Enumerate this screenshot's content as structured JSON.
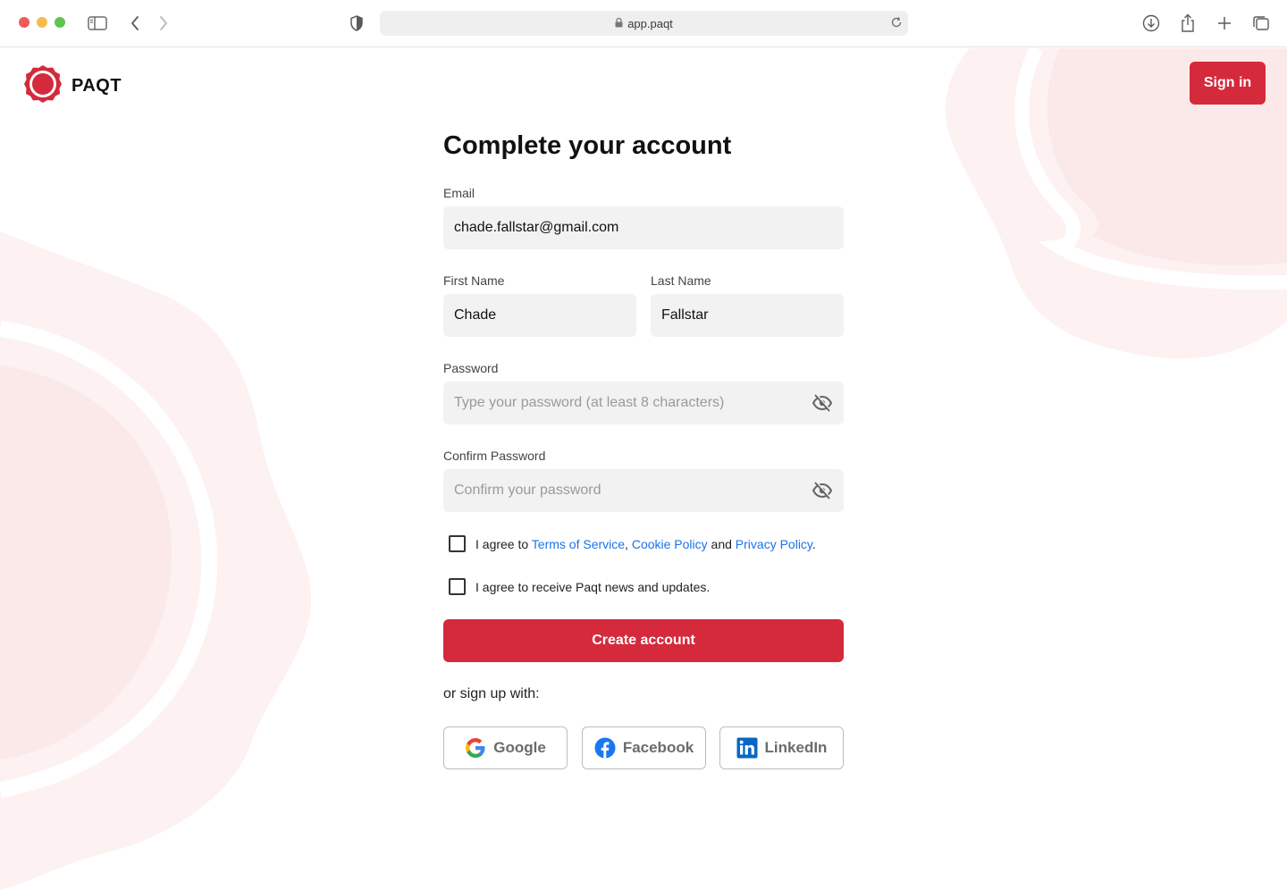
{
  "browser": {
    "url": "app.paqt"
  },
  "header": {
    "brand": "PAQT",
    "signin_label": "Sign in"
  },
  "form": {
    "title": "Complete your account",
    "email": {
      "label": "Email",
      "value": "chade.fallstar@gmail.com"
    },
    "first_name": {
      "label": "First Name",
      "value": "Chade"
    },
    "last_name": {
      "label": "Last Name",
      "value": "Fallstar"
    },
    "password": {
      "label": "Password",
      "placeholder": "Type your password (at least 8 characters)"
    },
    "confirm_password": {
      "label": "Confirm Password",
      "placeholder": "Confirm your password"
    },
    "terms": {
      "prefix": "I agree to ",
      "tos": "Terms of Service",
      "comma": ",",
      "cookie": "Cookie Policy",
      "and": " and ",
      "privacy": "Privacy Policy",
      "period": "."
    },
    "news": "I agree to receive Paqt news and updates.",
    "create_label": "Create account",
    "or_text": "or sign up with:",
    "social": {
      "google": "Google",
      "facebook": "Facebook",
      "linkedin": "LinkedIn"
    }
  },
  "colors": {
    "brand": "#d42a3c",
    "link": "#1a73e8",
    "field_bg": "#f2f2f2",
    "bg_shape": "#fdf1f1"
  },
  "icons": [
    "sidebar-icon",
    "back-icon",
    "forward-icon",
    "shield-icon",
    "lock-icon",
    "reload-icon",
    "download-icon",
    "share-icon",
    "new-tab-icon",
    "tabs-icon",
    "paqt-logo-icon",
    "eye-off-icon",
    "google-icon",
    "facebook-icon",
    "linkedin-icon"
  ]
}
